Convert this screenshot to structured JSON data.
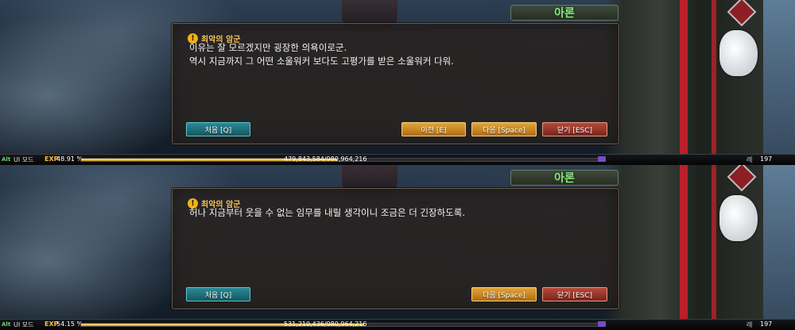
{
  "panels": [
    {
      "name_plate": "아론",
      "dialog": {
        "title": "최악의 암군",
        "lines": [
          "이유는 잘 모르겠지만 굉장한 의욕이로군.",
          "역시 지금까지 그 어떤 소울워커 보다도 고평가를 받은 소울워커 다워."
        ],
        "buttons": {
          "first": "처음 [Q]",
          "prev": "이전 [E]",
          "next": "다음 [Space]",
          "close": "닫기 [ESC]"
        }
      },
      "hud": {
        "alt": "Alt",
        "ui_mode": "UI 모드",
        "exp_label": "EXP",
        "exp_percent": "48.91 %",
        "exp_ratio": 0.4891,
        "exp_values": "479,843,584/980,964,216",
        "right_label": "레",
        "level": "197"
      }
    },
    {
      "name_plate": "아론",
      "dialog": {
        "title": "최악의 암군",
        "lines": [
          "허나 지금부터 웃을 수 없는 임무를 내릴 생각이니 조금은 더 긴장하도록."
        ],
        "buttons": {
          "first": "처음 [Q]",
          "next": "다음 [Space]",
          "close": "닫기 [ESC]"
        }
      },
      "hud": {
        "alt": "Alt",
        "ui_mode": "UI 모드",
        "exp_label": "EXP",
        "exp_percent": "54.15 %",
        "exp_ratio": 0.5415,
        "exp_values": "531,210,436/980,964,216",
        "right_label": "레",
        "level": "197"
      }
    }
  ],
  "colors": {
    "dialog_title": "#f4c45a",
    "name_plate_text": "#8fe08a",
    "button_teal": "#2b8a95",
    "button_orange": "#e3a43a",
    "button_red": "#b64a3c",
    "exp_fill": "#d49a14"
  },
  "icons": {
    "dialog_title_icon": "warning-icon"
  }
}
